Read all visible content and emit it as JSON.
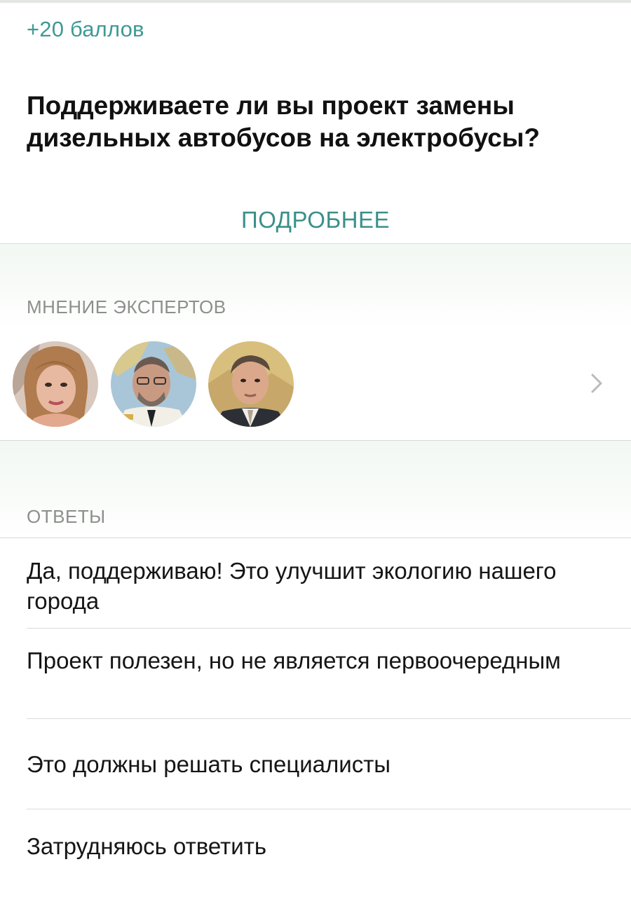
{
  "poll": {
    "points": "+20 баллов",
    "question": "Поддерживаете ли вы проект замены дизельных автобусов на электробусы?",
    "more_label": "ПОДРОБНЕЕ"
  },
  "experts": {
    "section_title": "МНЕНИЕ ЭКСПЕРТОВ",
    "avatars": [
      "expert-1",
      "expert-2",
      "expert-3"
    ]
  },
  "answers": {
    "section_title": "ОТВЕТЫ",
    "items": [
      {
        "label": "Да, поддерживаю! Это улучшит экологию нашего города"
      },
      {
        "label": "Проект полезен, но не является первоочередным"
      },
      {
        "label": "Это должны решать специалисты"
      },
      {
        "label": "Затрудняюсь ответить"
      }
    ]
  },
  "colors": {
    "accent": "#3a8f8a",
    "section_background": "#f3f8f3",
    "divider": "#d9dcd9"
  }
}
